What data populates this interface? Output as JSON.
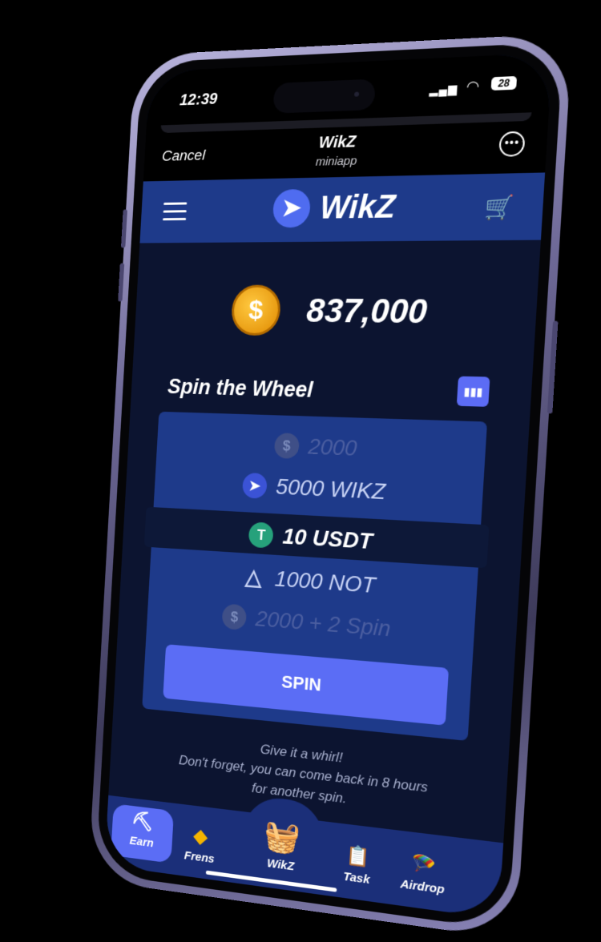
{
  "status": {
    "time": "12:39",
    "battery": "28"
  },
  "telegram": {
    "cancel": "Cancel",
    "title": "WikZ",
    "subtitle": "miniapp"
  },
  "appbar": {
    "brand": "WikZ"
  },
  "balance": {
    "coin_icon": "dollar-coin-icon",
    "value": "837,000"
  },
  "spin": {
    "title": "Spin the Wheel",
    "prizes": [
      {
        "label": "2000",
        "icon": "coin-icon"
      },
      {
        "label": "5000 WIKZ",
        "icon": "wikz-icon"
      },
      {
        "label": "10 USDT",
        "icon": "usdt-icon"
      },
      {
        "label": "1000 NOT",
        "icon": "notcoin-icon"
      },
      {
        "label": "2000 + 2 Spin",
        "icon": "coin-icon"
      }
    ],
    "button": "SPIN"
  },
  "hint": {
    "line1": "Give it a whirl!",
    "line2": "Don't forget, you can come back in 8 hours",
    "line3": "for another spin."
  },
  "tabs": {
    "earn": "Earn",
    "frens": "Frens",
    "wikz": "WikZ",
    "task": "Task",
    "airdrop": "Airdrop"
  },
  "colors": {
    "accent": "#5b6df5",
    "appbar": "#1e3a8a",
    "background": "#0c1430"
  }
}
